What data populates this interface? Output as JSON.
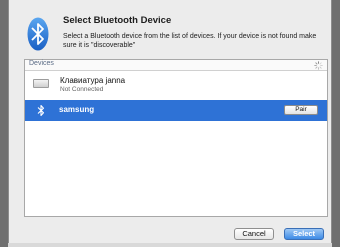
{
  "dialog": {
    "title": "Select Bluetooth Device",
    "description": "Select a Bluetooth device from the list of devices. If your device is not found make sure it is \"discoverable\"",
    "icon": "bluetooth-icon"
  },
  "devices": {
    "header_label": "Devices",
    "loading_icon": "spinner-icon",
    "items": [
      {
        "name": "Клавиатура janna",
        "status": "Not Connected",
        "icon": "keyboard-icon",
        "selected": false
      },
      {
        "name": "samsung",
        "status": "",
        "icon": "bluetooth-icon",
        "selected": true,
        "action_label": "Pair"
      }
    ]
  },
  "footer": {
    "cancel_label": "Cancel",
    "select_label": "Select"
  },
  "colors": {
    "selection": "#2e72d6",
    "bluetooth_blue": "#2d7ad6",
    "default_button": "#3d8be6"
  }
}
